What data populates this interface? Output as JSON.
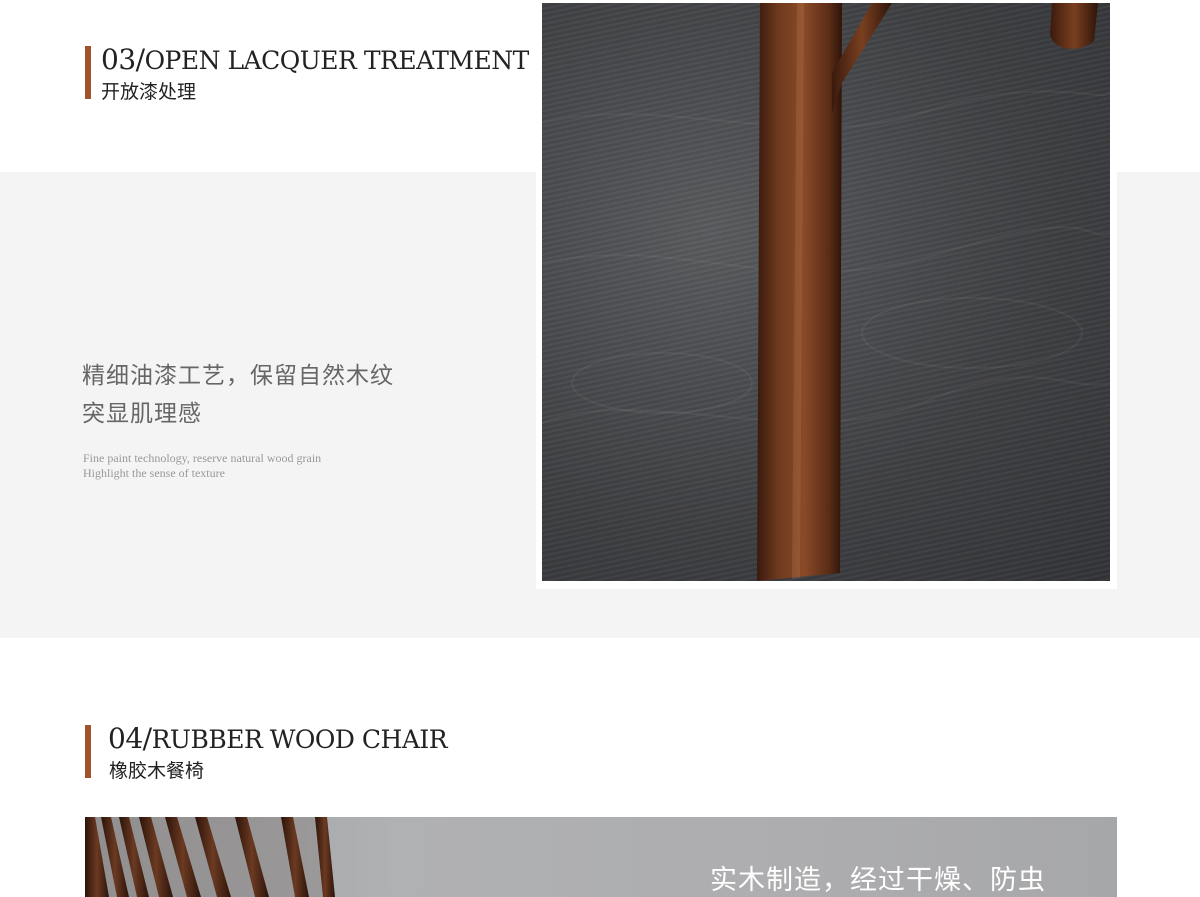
{
  "section3": {
    "number": "03/",
    "title": "Open Lacquer Treatment",
    "subtitle": "开放漆处理",
    "heading_line1": "精细油漆工艺，保留自然木纹",
    "heading_line2": "突显肌理感",
    "desc_line1": "Fine paint technology, reserve natural wood grain",
    "desc_line2": "Highlight the sense of texture"
  },
  "section4": {
    "number": "04/",
    "title": "Rubber wood chair",
    "subtitle": "橡胶木餐椅",
    "banner_text": "实木制造，经过干燥、防虫"
  },
  "colors": {
    "accent_bar": "#a0522d",
    "wood": "#6b3a22",
    "band": "#f4f4f4"
  }
}
